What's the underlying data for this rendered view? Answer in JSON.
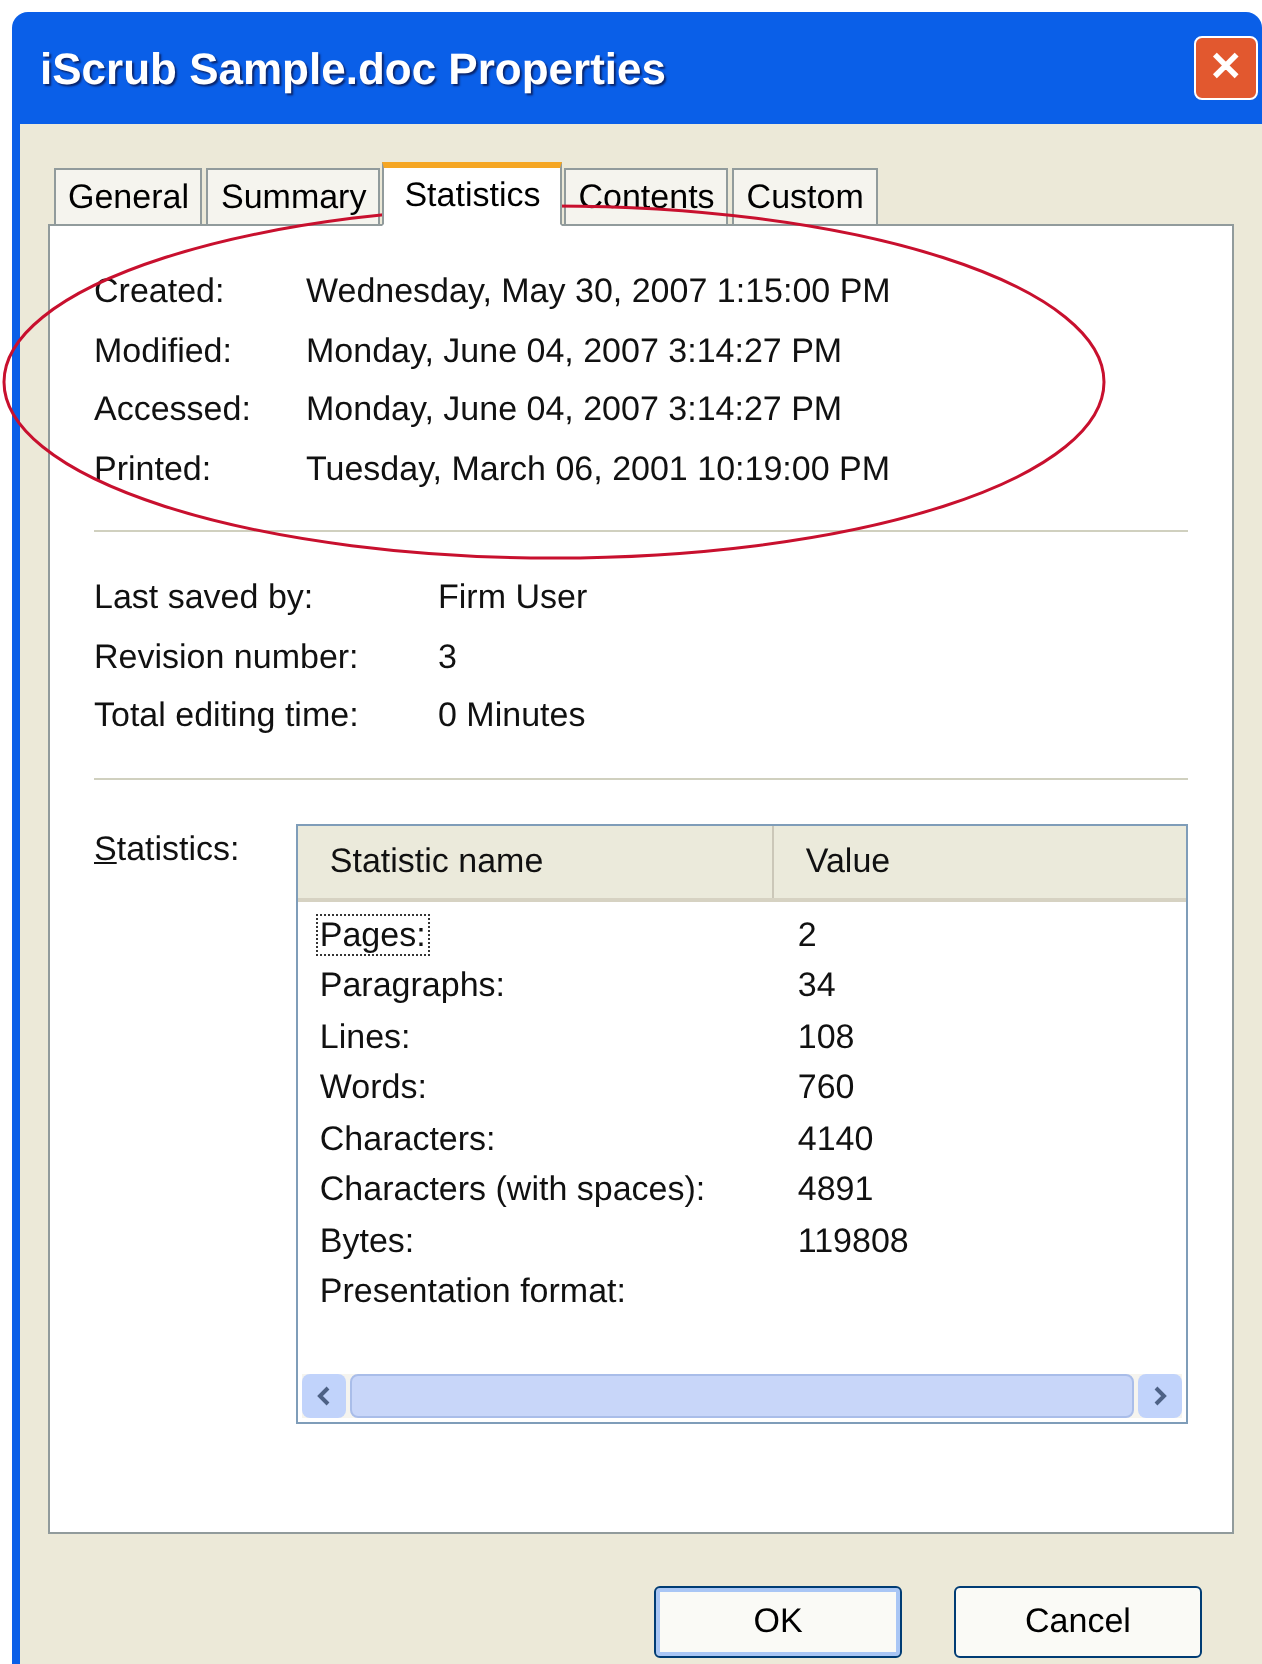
{
  "window": {
    "title": "iScrub Sample.doc Properties",
    "close": "✕"
  },
  "tabs": [
    {
      "label": "General",
      "selected": false
    },
    {
      "label": "Summary",
      "selected": false
    },
    {
      "label": "Statistics",
      "selected": true
    },
    {
      "label": "Contents",
      "selected": false
    },
    {
      "label": "Custom",
      "selected": false
    }
  ],
  "dates": [
    {
      "label": "Created:",
      "value": "Wednesday, May 30, 2007 1:15:00 PM"
    },
    {
      "label": "Modified:",
      "value": "Monday, June 04, 2007 3:14:27 PM"
    },
    {
      "label": "Accessed:",
      "value": "Monday, June 04, 2007 3:14:27 PM"
    },
    {
      "label": "Printed:",
      "value": "Tuesday, March 06, 2001 10:19:00 PM"
    }
  ],
  "info": [
    {
      "label": "Last saved by:",
      "value": "Firm User"
    },
    {
      "label": "Revision number:",
      "value": "3"
    },
    {
      "label": "Total editing time:",
      "value": "0 Minutes"
    }
  ],
  "statistics": {
    "label": "Statistics:",
    "columns": [
      "Statistic name",
      "Value"
    ],
    "rows": [
      {
        "name": "Pages:",
        "value": "2",
        "selected": true
      },
      {
        "name": "Paragraphs:",
        "value": "34",
        "selected": false
      },
      {
        "name": "Lines:",
        "value": "108",
        "selected": false
      },
      {
        "name": "Words:",
        "value": "760",
        "selected": false
      },
      {
        "name": "Characters:",
        "value": "4140",
        "selected": false
      },
      {
        "name": "Characters (with spaces):",
        "value": "4891",
        "selected": false
      },
      {
        "name": "Bytes:",
        "value": "119808",
        "selected": false
      },
      {
        "name": "Presentation format:",
        "value": "",
        "selected": false
      }
    ]
  },
  "buttons": [
    "OK",
    "Cancel"
  ]
}
